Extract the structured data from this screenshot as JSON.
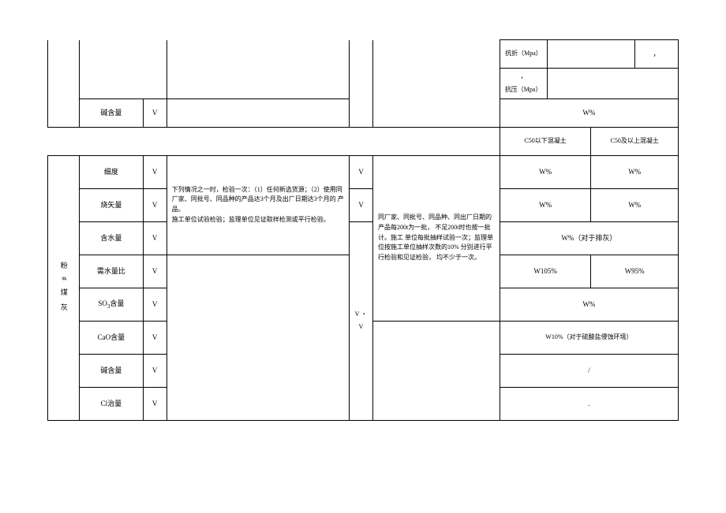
{
  "top_right": {
    "r1_label": "抗折（Mpa）",
    "r1_val": "，",
    "r2_mark": "，",
    "r2_label": "抗压（Mpa）"
  },
  "row_alkali_top": {
    "name": "碱含量",
    "mark": "V",
    "value": "W%"
  },
  "concrete_header": {
    "below": "C50以下混凝土",
    "above": "C50及以上混凝土"
  },
  "category": "粉 # 煤 灰",
  "desc_block": "下列情况之一时，检验一次：（1）任何新选货源；（2）使用同厂家、同批号、同品种的产品达3个月及出厂日期达3个月的 产品。\n施工单位试验检验；监理单位见证取样检测或平行检验。",
  "mid_vmarks": "V ・ V",
  "sampling_block": "同厂家、同批号、同品种、同出厂日期的产品每200t为一批， 不足200t时也按一批计。施工 单位每批抽样试验一次；监理单 位按施工单位抽样次数的10% 分别进行平行检验和见证检验， 均不少于一次。",
  "rows": {
    "fineness": {
      "name": "细度",
      "mark": "V",
      "smark": "V",
      "v1": "W%",
      "v2": "W%"
    },
    "loi": {
      "name": "烧矢量",
      "mark": "V",
      "smark": "V",
      "v1": "W%",
      "v2": "W%"
    },
    "water": {
      "name": "含水量",
      "mark": "V",
      "val": "W%（对于排灰）"
    },
    "demand": {
      "name": "需水量比",
      "mark": "V",
      "smark": "V",
      "v1": "W105%",
      "v2": "W95%"
    },
    "so3": {
      "name": "SO₃含量",
      "mark": "V",
      "val": "W%"
    },
    "cao": {
      "name": "CaO含量",
      "mark": "V",
      "smark": "，",
      "val": "W10%（对于硫酸盐侵蚀环境）"
    },
    "alkali": {
      "name": "碱含量",
      "mark": "V",
      "val": "/"
    },
    "cl": {
      "name": "Cl治量",
      "mark": "V",
      "val": "."
    }
  }
}
